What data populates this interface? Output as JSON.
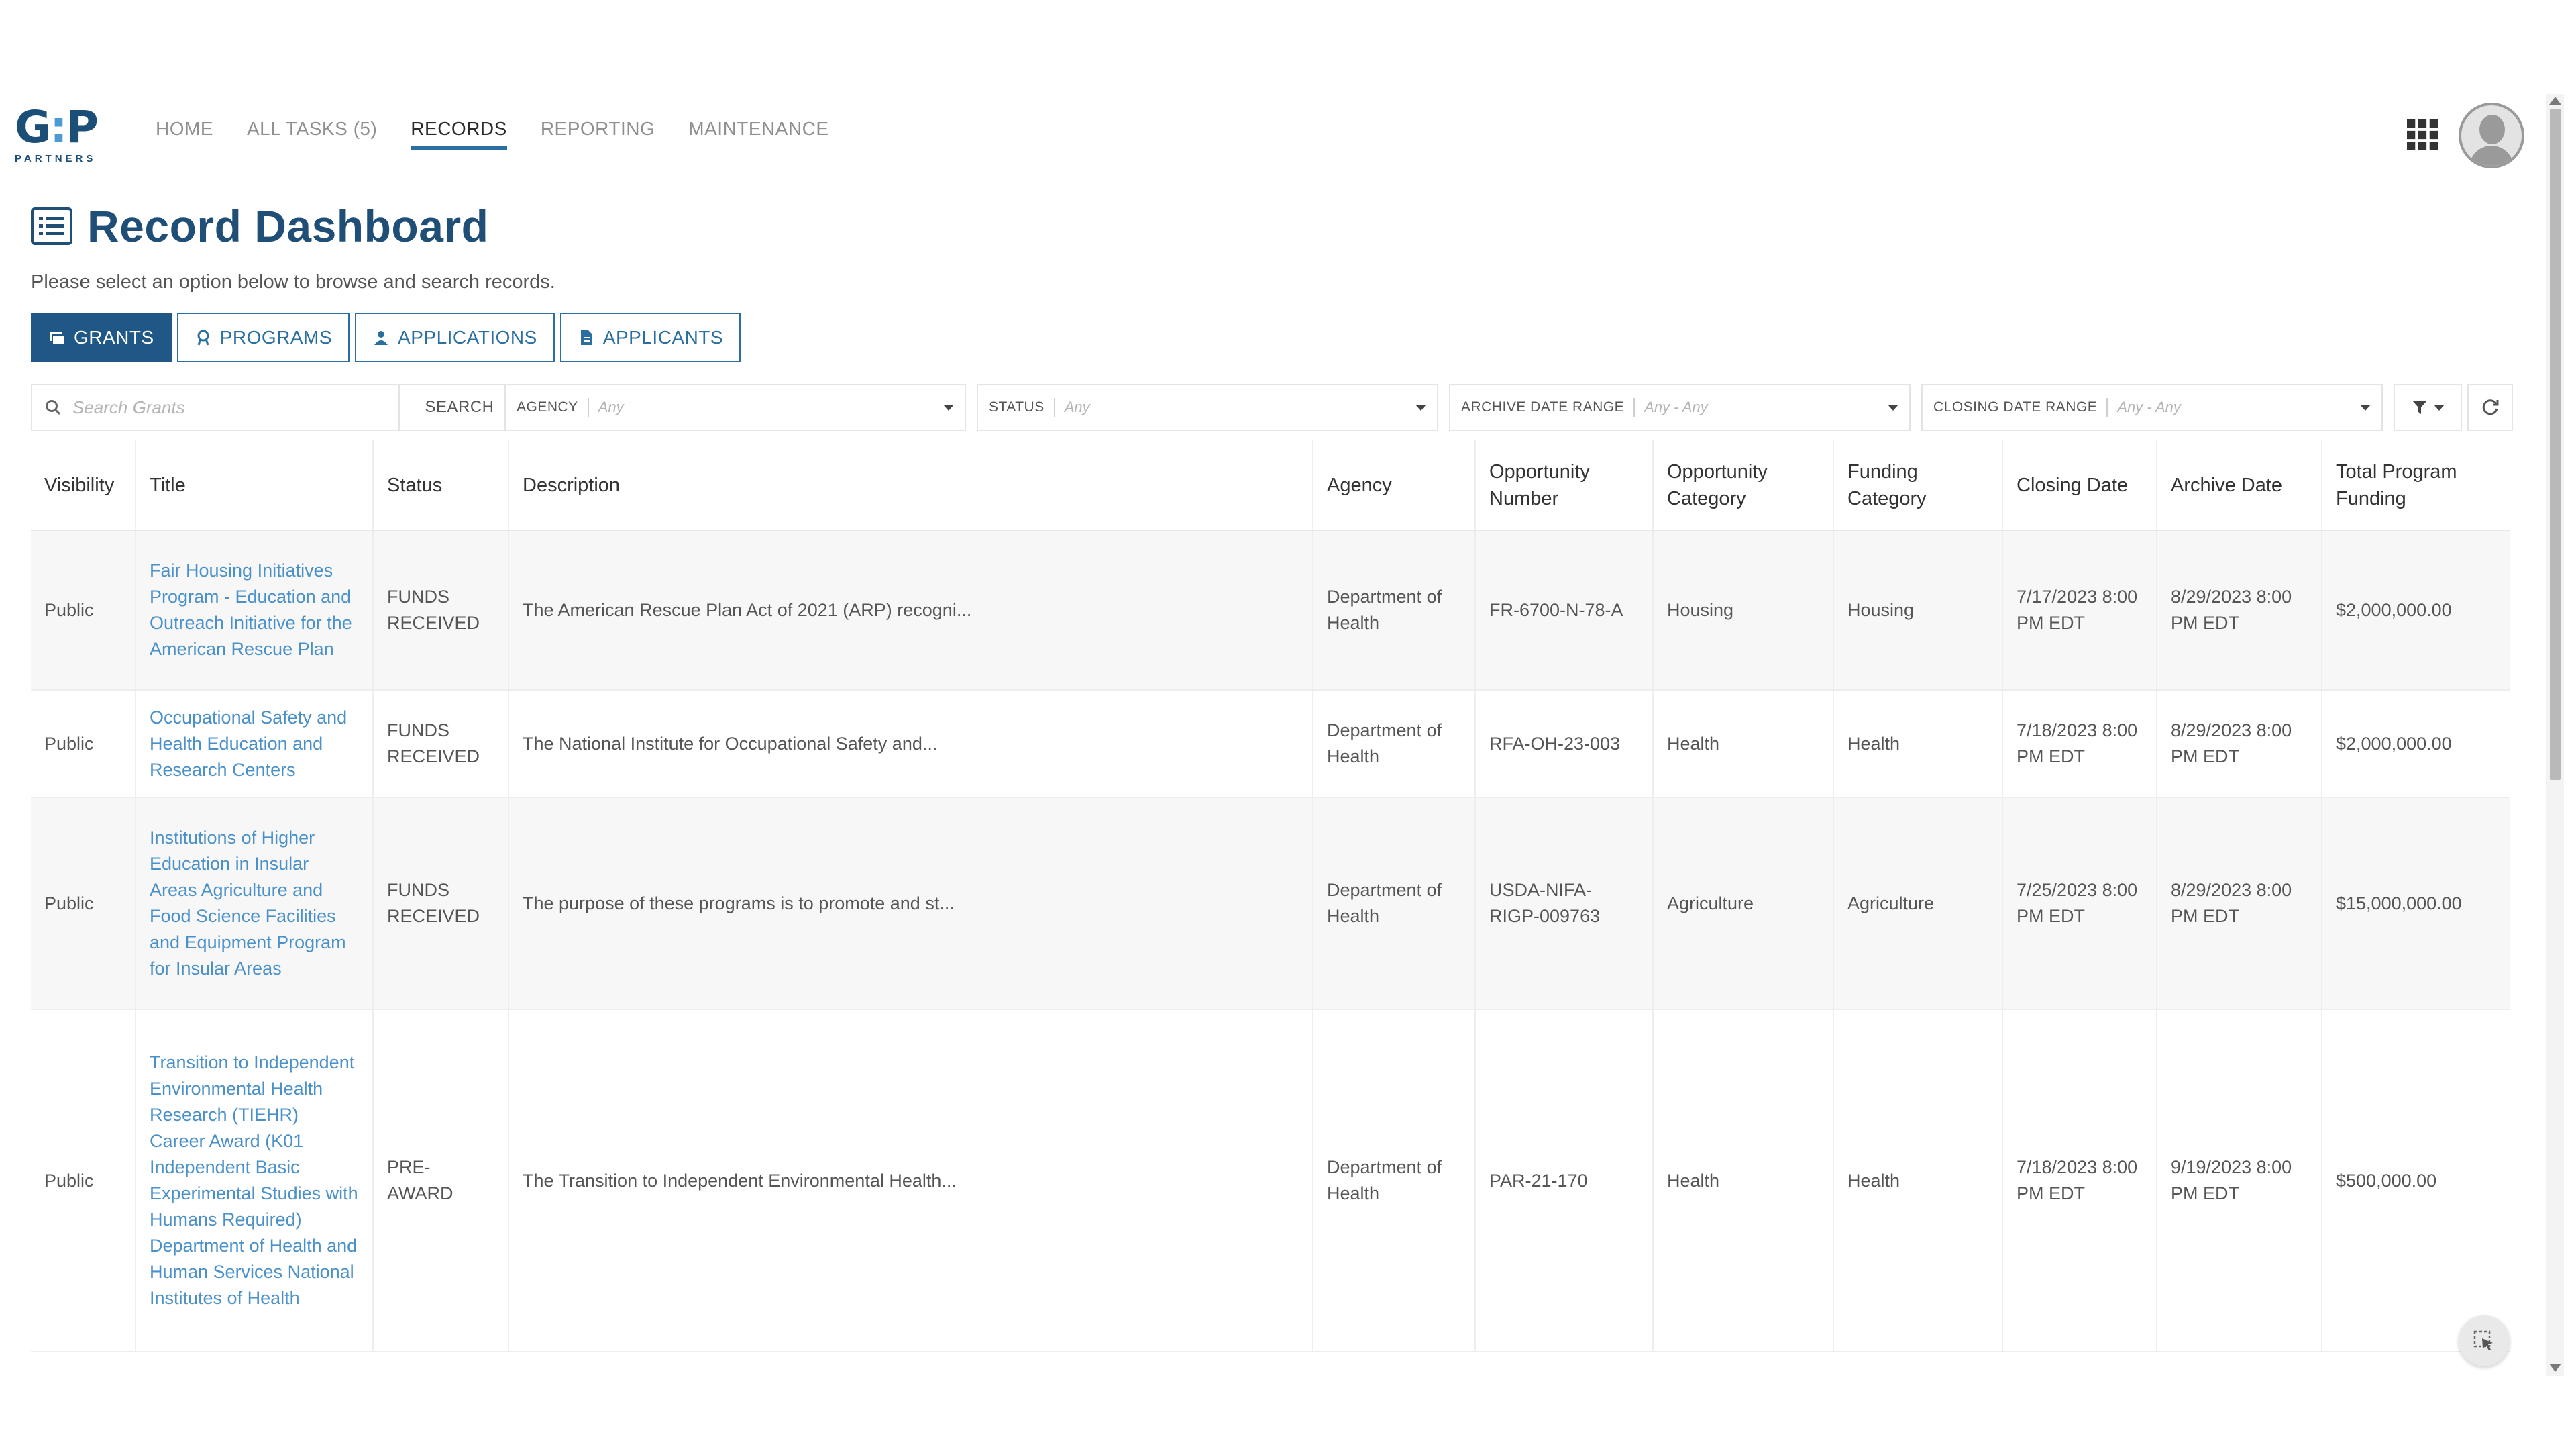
{
  "nav": {
    "logo_main": "G:P",
    "logo_sub": "PARTNERS",
    "links": [
      {
        "label": "HOME"
      },
      {
        "label": "ALL TASKS (5)"
      },
      {
        "label": "RECORDS"
      },
      {
        "label": "REPORTING"
      },
      {
        "label": "MAINTENANCE"
      }
    ],
    "active_link": "RECORDS"
  },
  "page": {
    "title": "Record Dashboard",
    "instructions": "Please select an option below to browse and search records."
  },
  "tabs": [
    {
      "label": "GRANTS",
      "icon": "grants-icon",
      "active": true
    },
    {
      "label": "PROGRAMS",
      "icon": "programs-icon",
      "active": false
    },
    {
      "label": "APPLICATIONS",
      "icon": "applications-icon",
      "active": false
    },
    {
      "label": "APPLICANTS",
      "icon": "applicants-icon",
      "active": false
    }
  ],
  "filters": {
    "search_placeholder": "Search Grants",
    "search_button": "SEARCH",
    "agency": {
      "label": "AGENCY",
      "value": "Any"
    },
    "status": {
      "label": "STATUS",
      "value": "Any"
    },
    "archive_date_range": {
      "label": "ARCHIVE DATE RANGE",
      "value": "Any - Any"
    },
    "closing_date_range": {
      "label": "CLOSING DATE RANGE",
      "value": "Any - Any"
    }
  },
  "table": {
    "headers": [
      "Visibility",
      "Title",
      "Status",
      "Description",
      "Agency",
      "Opportunity Number",
      "Opportunity Category",
      "Funding Category",
      "Closing Date",
      "Archive Date",
      "Total Program Funding"
    ],
    "rows": [
      {
        "visibility": "Public",
        "title": "Fair Housing Initiatives Program - Education and Outreach Initiative for the American Rescue Plan",
        "status": "FUNDS RECEIVED",
        "description": "The American Rescue Plan Act of 2021 (ARP) recogni...",
        "agency": "Department of Health",
        "opportunity_number": "FR-6700-N-78-A",
        "opportunity_category": "Housing",
        "funding_category": "Housing",
        "closing_date": "7/17/2023 8:00 PM EDT",
        "archive_date": "8/29/2023 8:00 PM EDT",
        "total_funding": "$2,000,000.00"
      },
      {
        "visibility": "Public",
        "title": "Occupational Safety and Health Education and Research Centers",
        "status": "FUNDS RECEIVED",
        "description": "The National Institute for Occupational Safety and...",
        "agency": "Department of Health",
        "opportunity_number": "RFA-OH-23-003",
        "opportunity_category": "Health",
        "funding_category": "Health",
        "closing_date": "7/18/2023 8:00 PM EDT",
        "archive_date": "8/29/2023 8:00 PM EDT",
        "total_funding": "$2,000,000.00"
      },
      {
        "visibility": "Public",
        "title": "Institutions of Higher Education in Insular Areas Agriculture and Food Science Facilities and Equipment Program for Insular Areas",
        "status": "FUNDS RECEIVED",
        "description": "The purpose of these programs is to promote and st...",
        "agency": "Department of Health",
        "opportunity_number": "USDA-NIFA-RIGP-009763",
        "opportunity_category": "Agriculture",
        "funding_category": "Agriculture",
        "closing_date": "7/25/2023 8:00 PM EDT",
        "archive_date": "8/29/2023 8:00 PM EDT",
        "total_funding": "$15,000,000.00"
      },
      {
        "visibility": "Public",
        "title": "Transition to Independent Environmental Health Research (TIEHR) Career Award (K01 Independent Basic Experimental Studies with Humans Required) Department of Health and Human Services National Institutes of Health",
        "status": "PRE-AWARD",
        "description": "The Transition to Independent Environmental Health...",
        "agency": "Department of Health",
        "opportunity_number": "PAR-21-170",
        "opportunity_category": "Health",
        "funding_category": "Health",
        "closing_date": "7/18/2023 8:00 PM EDT",
        "archive_date": "9/19/2023 8:00 PM EDT",
        "total_funding": "$500,000.00"
      }
    ]
  },
  "colors": {
    "brand": "#1f4f76",
    "accent": "#2a6fa0",
    "link": "#4a90c9"
  }
}
